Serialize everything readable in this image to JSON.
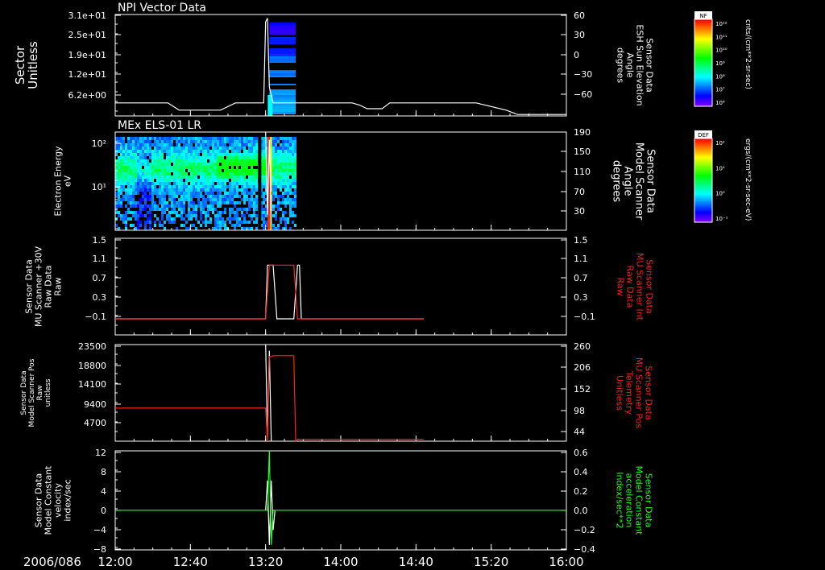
{
  "chart_data": {
    "type": "multi-panel time series and spectrogram",
    "date_label": "2006/086",
    "x_axis": {
      "range": [
        "12:00",
        "16:00"
      ],
      "tick_labels": [
        "12:00",
        "12:40",
        "13:20",
        "14:00",
        "14:40",
        "15:20",
        "16:00"
      ]
    },
    "panels": [
      {
        "title": "NPI Vector Data",
        "type": "spectrogram + line",
        "left_label": [
          "Sector",
          "Unitless"
        ],
        "left_tick_labels": [
          "3.1e+01",
          "2.5e+01",
          "1.9e+01",
          "1.2e+01",
          "6.2e+00"
        ],
        "right_label": [
          "Sensor Data",
          "ESH Sun Elevation",
          "Angle",
          "degrees"
        ],
        "right_tick_labels": [
          "60",
          "30",
          "0",
          "−30",
          "−60"
        ],
        "right_range": [
          -80,
          60
        ],
        "colorbar": {
          "label": "NF",
          "units": "cnts/(cm**2-sr-sec)",
          "tick_labels": [
            "10¹²",
            "10¹¹",
            "10¹⁰",
            "10⁹",
            "10⁸",
            "10⁷",
            "10⁶"
          ]
        },
        "line_series": {
          "name": "ESH Sun Elevation Angle",
          "color": "#ffffff",
          "points": [
            [
              "12:00",
              -62
            ],
            [
              "12:28",
              -62
            ],
            [
              "12:34",
              -72
            ],
            [
              "12:56",
              -72
            ],
            [
              "13:04",
              -62
            ],
            [
              "13:19",
              -62
            ],
            [
              "13:20",
              50
            ],
            [
              "13:21",
              55
            ],
            [
              "13:22",
              -40
            ],
            [
              "13:24",
              -62
            ],
            [
              "14:06",
              -62
            ],
            [
              "14:10",
              -65
            ],
            [
              "14:14",
              -70
            ],
            [
              "14:22",
              -70
            ],
            [
              "14:26",
              -62
            ],
            [
              "14:50",
              -62
            ],
            [
              "15:12",
              -62
            ],
            [
              "15:28",
              -72
            ],
            [
              "15:34",
              -78
            ],
            [
              "16:00",
              -78
            ]
          ]
        }
      },
      {
        "title": "MEx ELS-01 LR",
        "type": "spectrogram + line",
        "left_label": [
          "Electron Energy",
          "eV"
        ],
        "left_tick_labels": [
          "10²",
          "10¹"
        ],
        "right_label": [
          "Sensor Data",
          "Model Scanner",
          "Angle",
          "degrees"
        ],
        "right_tick_labels": [
          "190",
          "150",
          "110",
          "70",
          "30"
        ],
        "right_range": [
          0,
          190
        ],
        "colorbar": {
          "label": "DEF",
          "units": "ergs/(cm**2-sr-sec-eV)",
          "tick_labels": [
            "10²",
            "10¹",
            "10⁰",
            "10⁻¹"
          ]
        },
        "line_series": {
          "name": "Model Scanner Angle",
          "color": "#ffffff",
          "points": [
            [
              "13:20",
              190
            ],
            [
              "13:21",
              30
            ],
            [
              "13:22",
              175
            ],
            [
              "13:23",
              10
            ]
          ]
        }
      },
      {
        "type": "line",
        "left_label": [
          "Sensor Data",
          "MU Scanner +30V",
          "Raw Data",
          "Raw"
        ],
        "left_tick_labels": [
          "1.5",
          "1.1",
          "0.7",
          "0.3",
          "−0.1"
        ],
        "right_label": [
          "Sensor Data",
          "MU Scanner Int",
          "Raw Data",
          "Raw"
        ],
        "right_tick_labels": [
          "1.5",
          "1.1",
          "0.7",
          "0.3",
          "−0.1"
        ],
        "range": [
          -0.3,
          1.5
        ],
        "series": [
          {
            "name": "MU Scanner +30V Raw Data",
            "color": "#ffffff",
            "points": [
              [
                "12:00",
                0
              ],
              [
                "13:20",
                0
              ],
              [
                "13:21",
                1
              ],
              [
                "13:24",
                1
              ],
              [
                "13:26",
                0
              ],
              [
                "13:35",
                0
              ],
              [
                "13:37",
                1
              ],
              [
                "13:38",
                1
              ],
              [
                "13:39",
                0
              ],
              [
                "14:44",
                0
              ]
            ]
          },
          {
            "name": "MU Scanner Int Raw Data",
            "color": "#ff2020",
            "points": [
              [
                "12:00",
                0
              ],
              [
                "13:20",
                0
              ],
              [
                "13:22",
                1
              ],
              [
                "13:35",
                1
              ],
              [
                "13:37",
                0
              ],
              [
                "14:44",
                0
              ]
            ]
          }
        ]
      },
      {
        "type": "line",
        "left_label": [
          "Sensor Data",
          "Model Scanner Pos",
          "Raw",
          "unitless"
        ],
        "left_tick_labels": [
          "23500",
          "18800",
          "14100",
          "9400",
          "4700"
        ],
        "left_range": [
          0,
          23500
        ],
        "right_label": [
          "Sensor Data",
          "MU Scanner Pos",
          "Telemetry",
          "Unitless"
        ],
        "right_tick_labels": [
          "260",
          "206",
          "152",
          "98",
          "44"
        ],
        "right_range": [
          0,
          260
        ],
        "series": [
          {
            "name": "Model Scanner Pos",
            "color": "#ffffff",
            "axis": "left",
            "points": [
              [
                "13:20",
                23500
              ],
              [
                "13:21",
                1000
              ],
              [
                "13:22",
                22000
              ],
              [
                "13:23",
                0
              ]
            ]
          },
          {
            "name": "MU Scanner Pos Telemetry",
            "color": "#ff2020",
            "axis": "right",
            "points": [
              [
                "12:00",
                89
              ],
              [
                "13:20",
                89
              ],
              [
                "13:21",
                0
              ],
              [
                "13:22",
                228
              ],
              [
                "13:23",
                228
              ],
              [
                "13:24",
                230
              ],
              [
                "13:35",
                230
              ],
              [
                "13:36",
                0
              ],
              [
                "13:37",
                5
              ],
              [
                "14:44",
                5
              ]
            ]
          }
        ]
      },
      {
        "type": "line",
        "left_label": [
          "Sensor Data",
          "Model Constant",
          "velocity",
          "index/sec"
        ],
        "left_tick_labels": [
          "12",
          "8",
          "4",
          "0",
          "−4",
          "−8"
        ],
        "left_range": [
          -8,
          12
        ],
        "right_label": [
          "Sensor Data",
          "Model Constant",
          "acceleration",
          "Index/sec**2"
        ],
        "right_tick_labels": [
          "0.6",
          "0.4",
          "0.2",
          "0.0",
          "−0.2",
          "−0.4"
        ],
        "right_range": [
          -0.4,
          0.6
        ],
        "series": [
          {
            "name": "Model Constant velocity",
            "color": "#ffffff",
            "axis": "left",
            "points": [
              [
                "13:20",
                0
              ],
              [
                "13:21",
                6
              ],
              [
                "13:22",
                -7
              ],
              [
                "13:23",
                6
              ],
              [
                "13:24",
                -4
              ],
              [
                "13:25",
                0
              ]
            ]
          },
          {
            "name": "Model Constant acceleration",
            "color": "#20ff20",
            "axis": "right",
            "points": [
              [
                "12:00",
                0
              ],
              [
                "13:21",
                0
              ],
              [
                "13:22",
                0.6
              ],
              [
                "13:23",
                -0.35
              ],
              [
                "13:24",
                0
              ],
              [
                "16:00",
                0
              ]
            ]
          }
        ]
      }
    ]
  }
}
